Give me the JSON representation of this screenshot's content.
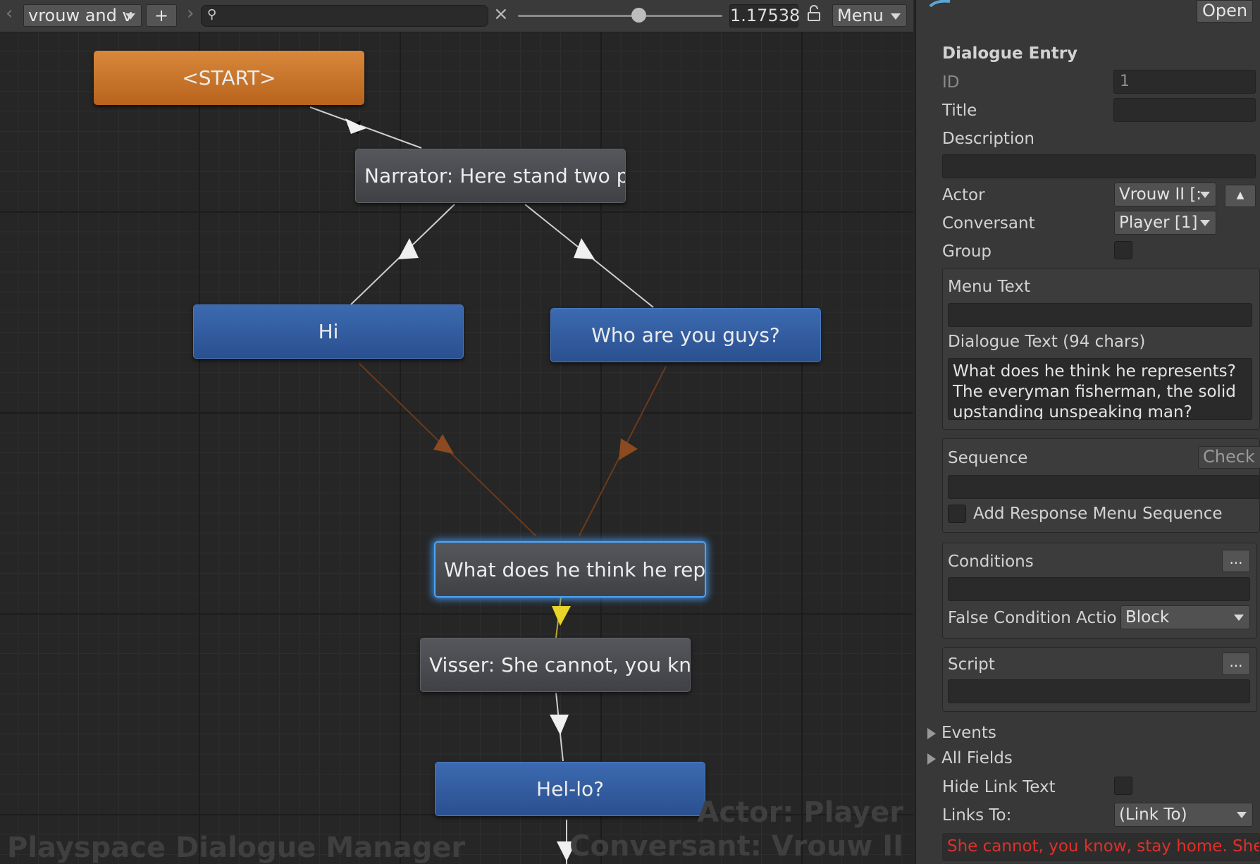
{
  "toolbar": {
    "conversation_select": "vrouw and v",
    "add_label": "+",
    "search_value": "",
    "clear_label": "×",
    "zoom_value": "1.17538",
    "zoom_level": 0.59,
    "menu_label": "Menu"
  },
  "graph": {
    "nodes": {
      "start": "<START>",
      "narrator": "Narrator: Here stand two p",
      "hi": "Hi",
      "who": "Who are you guys?",
      "what": "What does he think he repr",
      "visser": "Visser: She cannot, you kn",
      "hello": "Hel-lo?"
    },
    "colors": {
      "start": "#c7762b",
      "npc": "#4a4c50",
      "player": "#3361a3",
      "selected_glow": "#4aa6ff",
      "link_normal": "#cfcfcf",
      "link_mixed": "#8b4a20",
      "link_selected": "#e8d42a"
    },
    "watermark_title": "Playspace Dialogue Manager",
    "watermark_actor": "Actor: Player",
    "watermark_conversant": "Conversant: Vrouw II"
  },
  "inspector": {
    "header_button": "Open",
    "section_title": "Dialogue Entry",
    "id_label": "ID",
    "id_value": "1",
    "title_label": "Title",
    "title_value": "",
    "description_label": "Description",
    "description_value": "",
    "actor_label": "Actor",
    "actor_value": "Vrouw II [:",
    "conversant_label": "Conversant",
    "conversant_value": "Player [1]",
    "group_label": "Group",
    "menu_text_label": "Menu Text",
    "menu_text_value": "",
    "dialogue_text_label": "Dialogue Text (94 chars)",
    "dialogue_text_value": "What does he think he represents? The everyman fisherman, the solid upstanding unspeaking man?",
    "sequence_label": "Sequence",
    "check_button": "Check",
    "sequence_value": "",
    "add_response_label": "Add Response Menu Sequence",
    "conditions_label": "Conditions",
    "conditions_button": "...",
    "conditions_value": "",
    "false_condition_label": "False Condition Actio",
    "false_condition_value": "Block",
    "script_label": "Script",
    "script_button": "...",
    "script_value": "",
    "events_label": "Events",
    "all_fields_label": "All Fields",
    "hide_link_label": "Hide Link Text",
    "links_to_label": "Links To:",
    "links_to_value": "(Link To)",
    "link_item": "She cannot, you know, stay home. She",
    "link_item_color": "#e0302a"
  }
}
